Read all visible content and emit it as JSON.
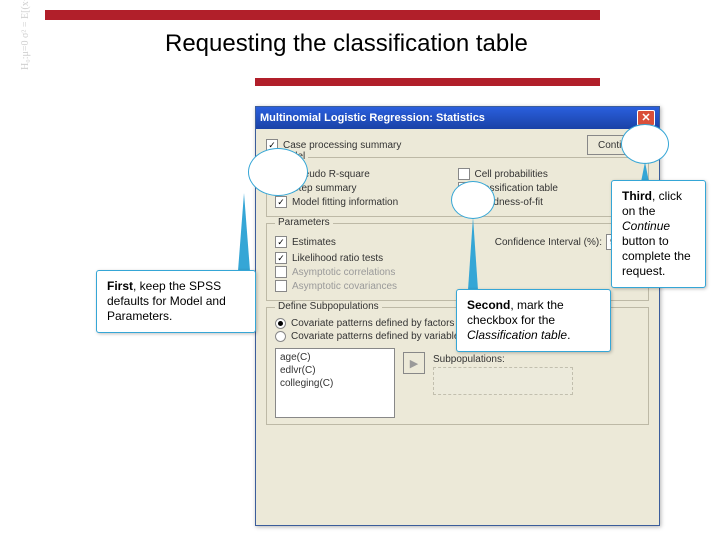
{
  "slide": {
    "title": "Requesting the classification table"
  },
  "dialog": {
    "title": "Multinomial Logistic Regression: Statistics",
    "top_checkbox": "Case processing summary",
    "continue_label": "Continue",
    "model": {
      "legend": "Model",
      "pseudo_r": "Pseudo R-square",
      "step_summary": "Step summary",
      "model_fit": "Model fitting information",
      "cell_prob": "Cell probabilities",
      "class_table": "Classification table",
      "goodness": "Goodness-of-fit"
    },
    "parameters": {
      "legend": "Parameters",
      "estimates": "Estimates",
      "conf_label": "Confidence Interval (%):",
      "conf_value": "95",
      "lr": "Likelihood ratio tests",
      "asym_corr": "Asymptotic correlations",
      "asym_cov": "Asymptotic covariances"
    },
    "subpop": {
      "legend": "Define Subpopulations",
      "r1": "Covariate patterns defined by factors and covariates",
      "r2": "Covariate patterns defined by variable list below",
      "subpop_label": "Subpopulations:",
      "vars": [
        "age(C)",
        "edlvr(C)",
        "colleging(C)"
      ]
    }
  },
  "callouts": {
    "first": {
      "lead": "First",
      "text": ", keep the SPSS defaults for Model and Parameters."
    },
    "second": {
      "lead": "Second",
      "text_a": ", mark the checkbox for the ",
      "italic": "Classification table",
      "text_b": "."
    },
    "third": {
      "lead": "Third",
      "text_a": ", click on the ",
      "italic": "Continue",
      "text_b": " button to complete the request."
    }
  }
}
